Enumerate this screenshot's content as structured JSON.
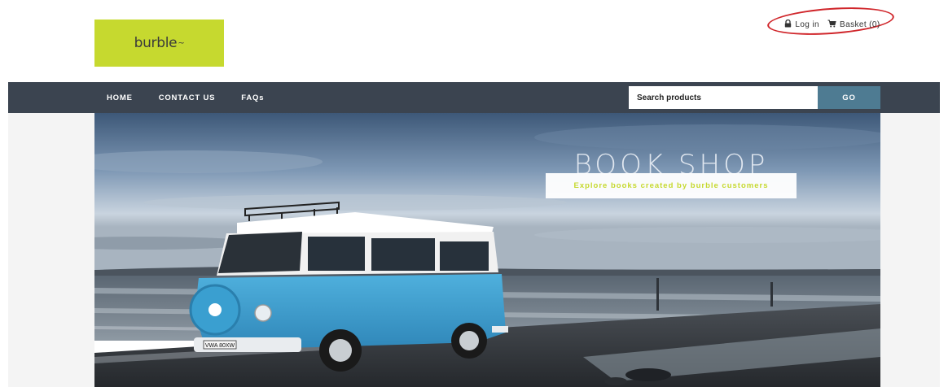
{
  "header": {
    "logo_text": "burble",
    "logo_mark": "~",
    "login_label": "Log in",
    "basket_label": "Basket (0)"
  },
  "nav": {
    "items": [
      "HOME",
      "CONTACT US",
      "FAQs"
    ]
  },
  "search": {
    "placeholder": "Search products",
    "button_label": "GO"
  },
  "hero": {
    "title": "BOOK SHOP",
    "subtitle": "Explore books created by burble customers",
    "van_plate": "VWA 80XW"
  },
  "colors": {
    "brand_green": "#c6d92f",
    "nav_bg": "#3b4450",
    "go_button": "#4e7b92",
    "annotation_red": "#d0262b"
  },
  "icons": {
    "login": "lock-icon",
    "basket": "cart-icon"
  }
}
